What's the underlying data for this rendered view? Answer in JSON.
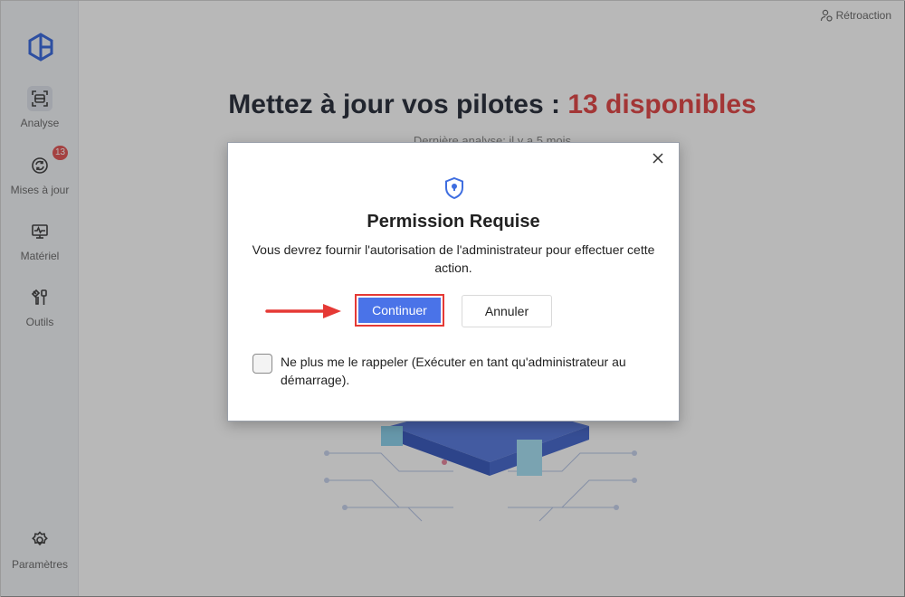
{
  "sidebar": {
    "items": [
      {
        "label": "Analyse",
        "icon": "scan-icon"
      },
      {
        "label": "Mises à jour",
        "icon": "refresh-icon",
        "badge": "13"
      },
      {
        "label": "Matériel",
        "icon": "monitor-icon"
      },
      {
        "label": "Outils",
        "icon": "tools-icon"
      }
    ],
    "settings_label": "Paramètres"
  },
  "header": {
    "feedback_label": "Rétroaction"
  },
  "main": {
    "headline_prefix": "Mettez à jour vos pilotes : ",
    "headline_highlight": "13 disponibles",
    "last_scan": "Dernière analyse: il y a 5 mois"
  },
  "dialog": {
    "title": "Permission Requise",
    "message": "Vous devrez fournir l'autorisation de l'administrateur pour effectuer cette action.",
    "continue_label": "Continuer",
    "cancel_label": "Annuler",
    "checkbox_label": "Ne plus me le rappeler (Exécuter en tant qu'administrateur au démarrage)."
  },
  "colors": {
    "accent": "#4a73e8",
    "highlight": "#e24b4b",
    "annotation": "#e53935"
  }
}
